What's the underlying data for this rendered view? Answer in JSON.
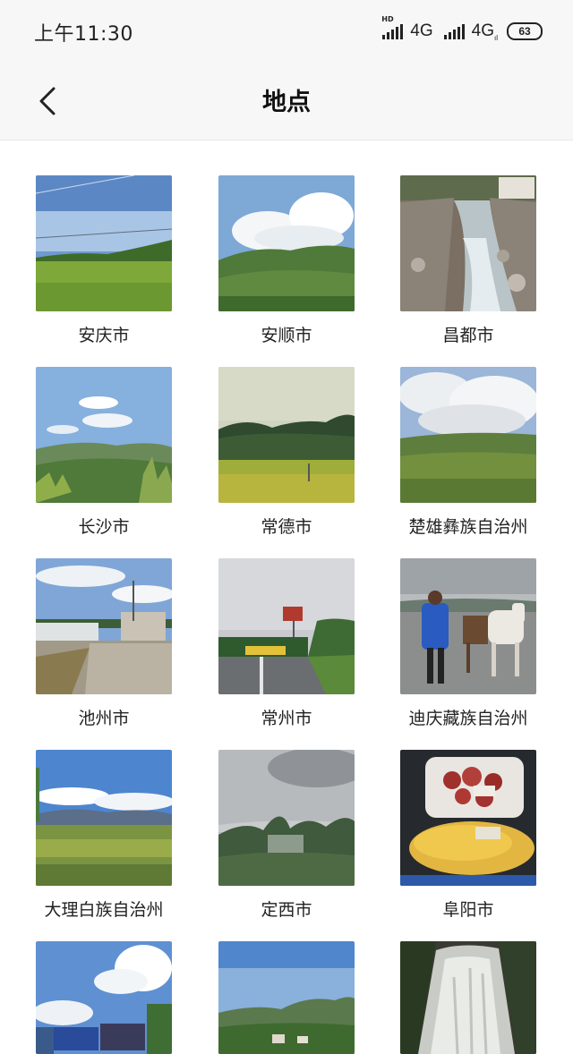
{
  "status_bar": {
    "time": "上午11:30",
    "hd": "HD",
    "network_1": "4G",
    "network_2": "4G",
    "network_2_sub": "ıl",
    "battery": "63"
  },
  "header": {
    "title": "地点",
    "back_icon": "chevron-left-icon"
  },
  "places": [
    {
      "label": "安庆市"
    },
    {
      "label": "安顺市"
    },
    {
      "label": "昌都市"
    },
    {
      "label": "长沙市"
    },
    {
      "label": "常德市"
    },
    {
      "label": "楚雄彝族自治州"
    },
    {
      "label": "池州市"
    },
    {
      "label": "常州市"
    },
    {
      "label": "迪庆藏族自治州"
    },
    {
      "label": "大理白族自治州"
    },
    {
      "label": "定西市"
    },
    {
      "label": "阜阳市"
    },
    {
      "label": ""
    },
    {
      "label": ""
    },
    {
      "label": ""
    }
  ]
}
